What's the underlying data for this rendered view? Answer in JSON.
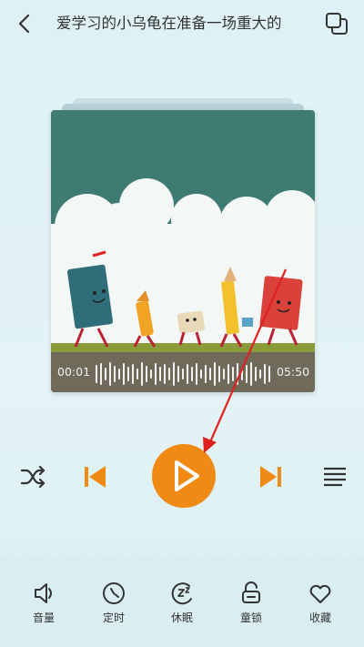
{
  "header": {
    "title": "爱学习的小乌龟在准备一场重大的",
    "back_icon": "chevron-left-icon",
    "switch_icon": "overlap-squares-icon"
  },
  "player": {
    "elapsed": "00:01",
    "duration": "05:50",
    "accent_color": "#f08a14",
    "controls": {
      "shuffle_icon": "shuffle-icon",
      "prev_icon": "skip-previous-icon",
      "play_icon": "play-icon",
      "next_icon": "skip-next-icon",
      "playlist_icon": "playlist-icon"
    }
  },
  "toolbar": {
    "items": [
      {
        "label": "音量",
        "icon": "speaker-icon"
      },
      {
        "label": "定时",
        "icon": "timer-icon"
      },
      {
        "label": "休眠",
        "icon": "sleep-icon"
      },
      {
        "label": "童锁",
        "icon": "lock-icon"
      },
      {
        "label": "收藏",
        "icon": "heart-icon"
      }
    ]
  }
}
